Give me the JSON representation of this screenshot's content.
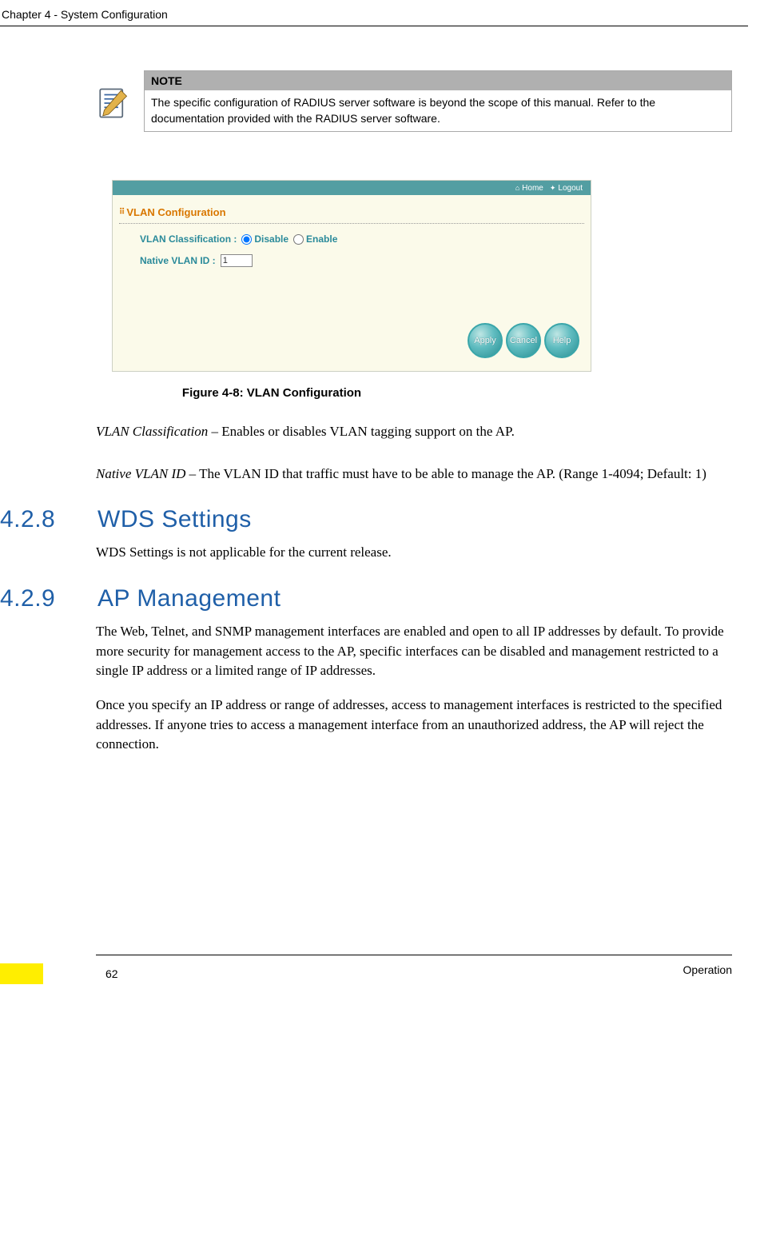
{
  "header": {
    "chapter": "Chapter 4 - System Configuration"
  },
  "note": {
    "label": "NOTE",
    "text": "The specific configuration of RADIUS server software is beyond the scope of this manual. Refer to the documentation provided with the RADIUS server software."
  },
  "panel": {
    "topbar": {
      "home": "Home",
      "logout": "Logout"
    },
    "title": "VLAN Configuration",
    "fields": {
      "classification_label": "VLAN Classification  :",
      "disable": "Disable",
      "enable": "Enable",
      "native_label": "Native VLAN ID  :",
      "native_value": "1"
    },
    "buttons": {
      "apply": "Apply",
      "cancel": "Cancel",
      "help": "Help"
    }
  },
  "figure_caption": "Figure 4-8: VLAN Configuration",
  "paras": {
    "vlan_class_prefix": "VLAN Classification",
    "vlan_class_rest": " – Enables or disables VLAN tagging support on the AP.",
    "native_prefix": "Native VLAN ID",
    "native_rest": " – The VLAN ID that traffic must have to be able to manage the AP. (Range 1-4094; Default: 1)"
  },
  "sections": {
    "s428_num": "4.2.8",
    "s428_title": "WDS Settings",
    "s428_body": "WDS Settings is not applicable for the current release.",
    "s429_num": "4.2.9",
    "s429_title": "AP Management",
    "s429_body1": "The Web, Telnet, and SNMP management interfaces are enabled and open to all IP addresses by default. To provide more security for management access to the AP, specific interfaces can be disabled and management restricted to a single IP address or a limited range of IP addresses.",
    "s429_body2": "Once you specify an IP address or range of addresses, access to management interfaces is restricted to the specified addresses. If anyone tries to access a management interface from an unauthorized address, the AP will reject the connection."
  },
  "footer": {
    "page": "62",
    "label": "Operation"
  }
}
